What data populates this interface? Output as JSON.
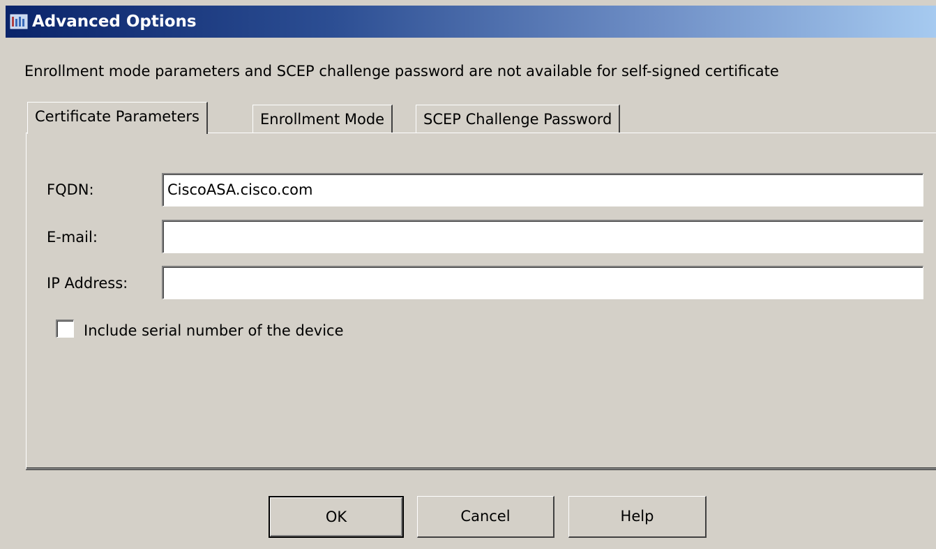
{
  "window": {
    "title": "Advanced Options",
    "icon": "cisco-app-icon"
  },
  "notice": "Enrollment mode parameters and SCEP challenge password are not available for self-signed certificate",
  "tabs": [
    {
      "label": "Certificate Parameters",
      "active": true
    },
    {
      "label": "Enrollment Mode",
      "active": false
    },
    {
      "label": "SCEP Challenge Password",
      "active": false
    }
  ],
  "form": {
    "fqdn": {
      "label": "FQDN:",
      "value": "CiscoASA.cisco.com"
    },
    "email": {
      "label": "E-mail:",
      "value": ""
    },
    "ip": {
      "label": "IP Address:",
      "value": ""
    },
    "serial": {
      "label": "Include serial number of the device",
      "checked": false
    }
  },
  "buttons": {
    "ok": "OK",
    "cancel": "Cancel",
    "help": "Help"
  }
}
